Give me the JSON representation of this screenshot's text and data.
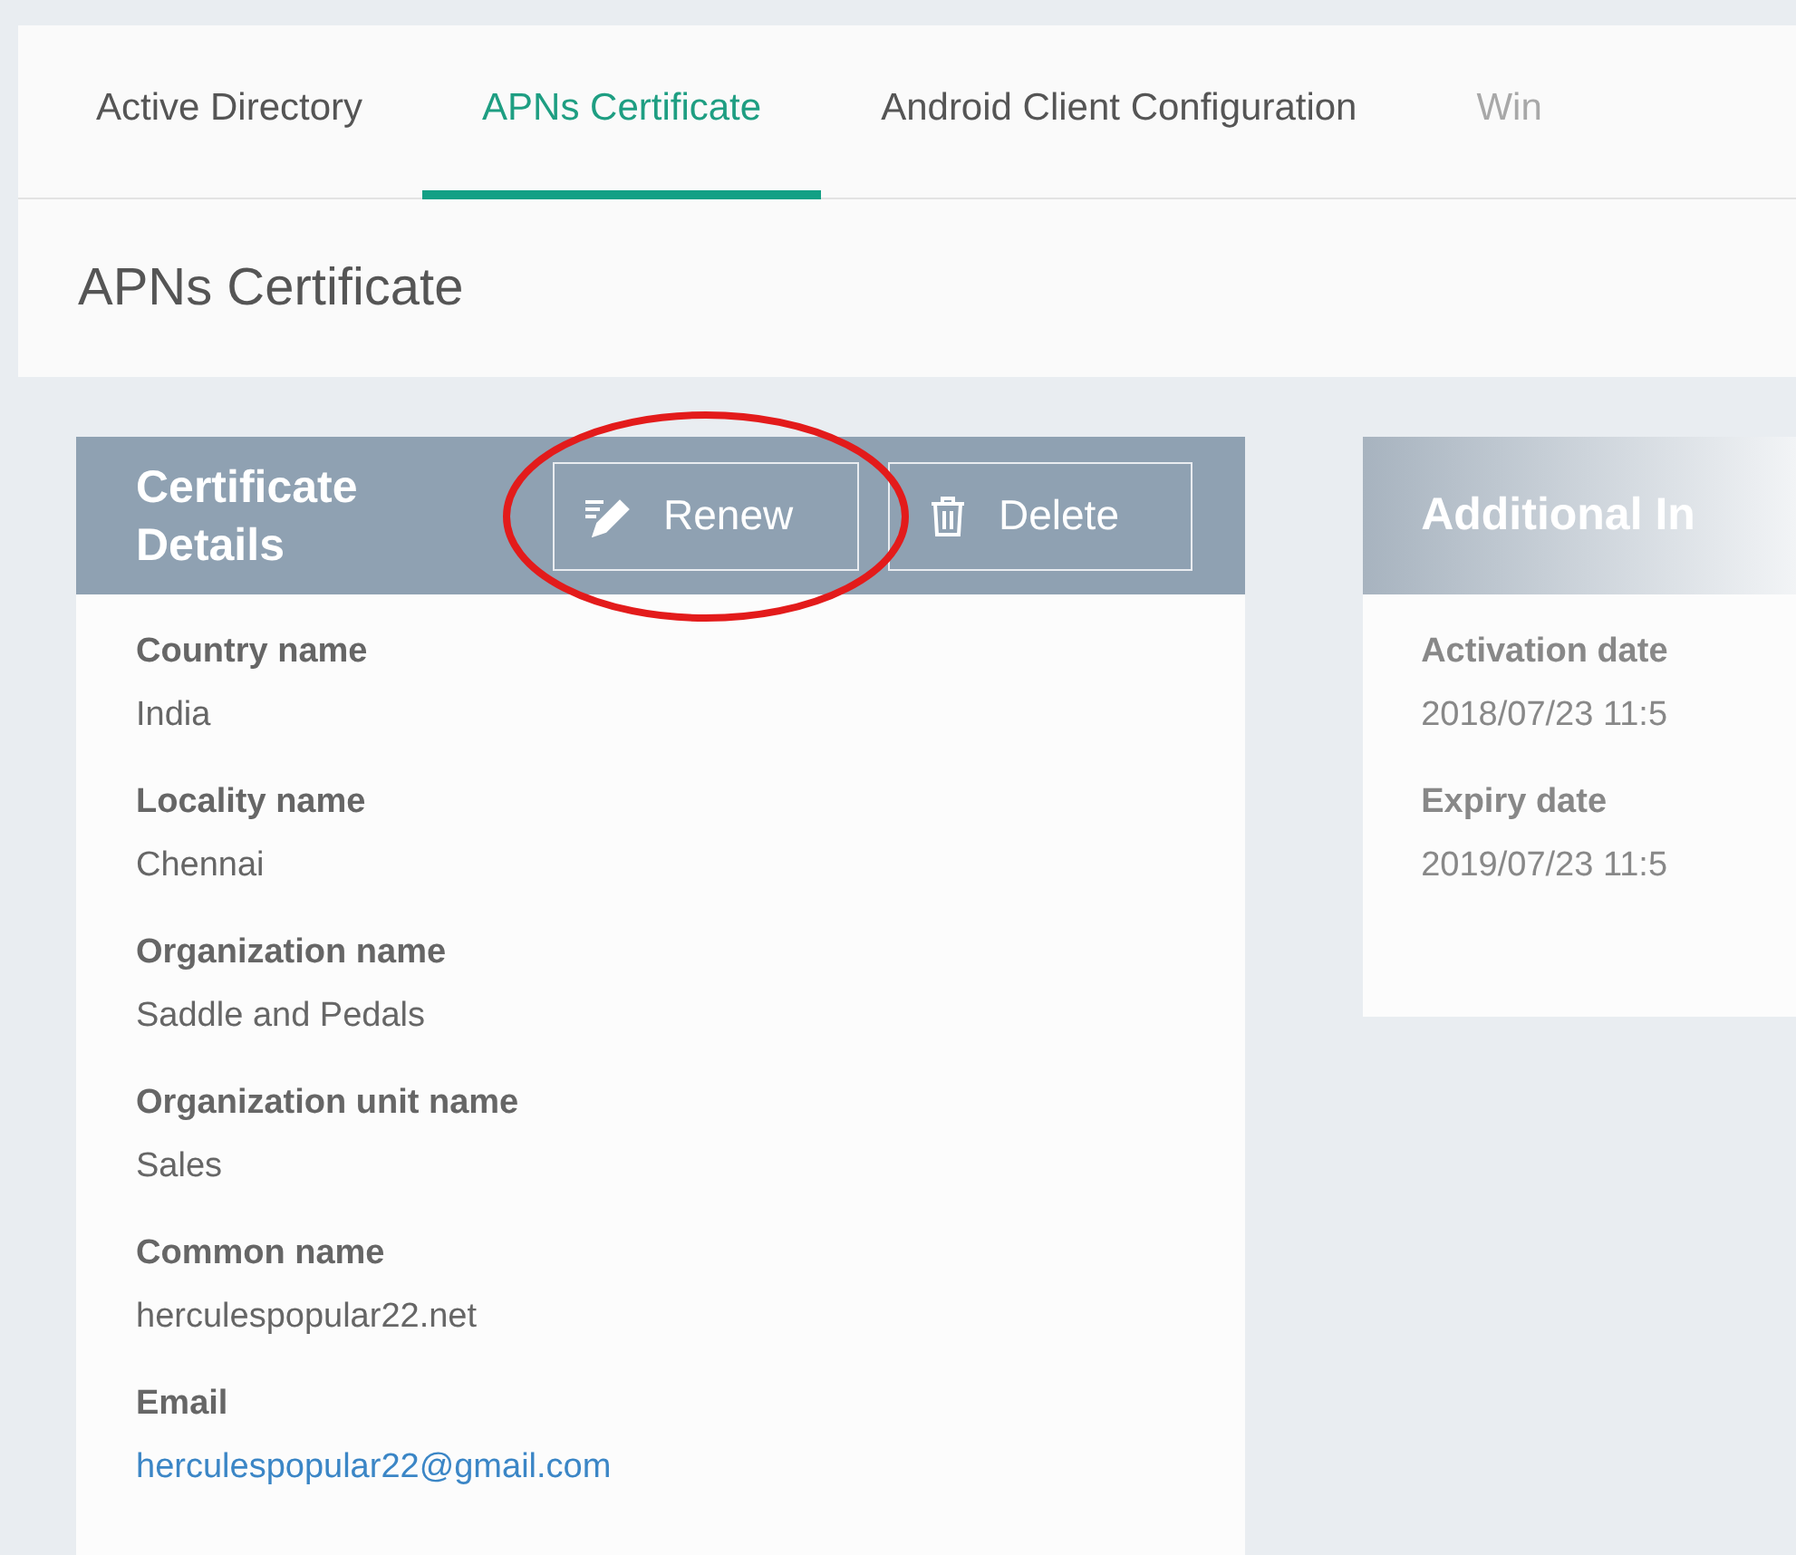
{
  "tabs": [
    {
      "label": "Active Directory",
      "selected": false
    },
    {
      "label": "APNs Certificate",
      "selected": true
    },
    {
      "label": "Android Client Configuration",
      "selected": false
    },
    {
      "label": "Win",
      "selected": false
    }
  ],
  "page_title": "APNs Certificate",
  "certificate_card": {
    "title": "Certificate Details",
    "buttons": [
      {
        "kind": "renew",
        "label": "Renew",
        "highlighted": true
      },
      {
        "kind": "delete",
        "label": "Delete",
        "highlighted": false
      }
    ],
    "fields": [
      {
        "label": "Country name",
        "value": "India",
        "kind": "text"
      },
      {
        "label": "Locality name",
        "value": "Chennai",
        "kind": "text"
      },
      {
        "label": "Organization name",
        "value": "Saddle and Pedals",
        "kind": "text"
      },
      {
        "label": "Organization unit name",
        "value": "Sales",
        "kind": "text"
      },
      {
        "label": "Common name",
        "value": "herculespopular22.net",
        "kind": "text"
      },
      {
        "label": "Email",
        "value": "herculespopular22@gmail.com",
        "kind": "link"
      }
    ]
  },
  "additional_card": {
    "title": "Additional In",
    "fields": [
      {
        "label": "Activation date",
        "value": "2018/07/23 11:5"
      },
      {
        "label": "Expiry date",
        "value": "2019/07/23 11:5"
      }
    ]
  }
}
